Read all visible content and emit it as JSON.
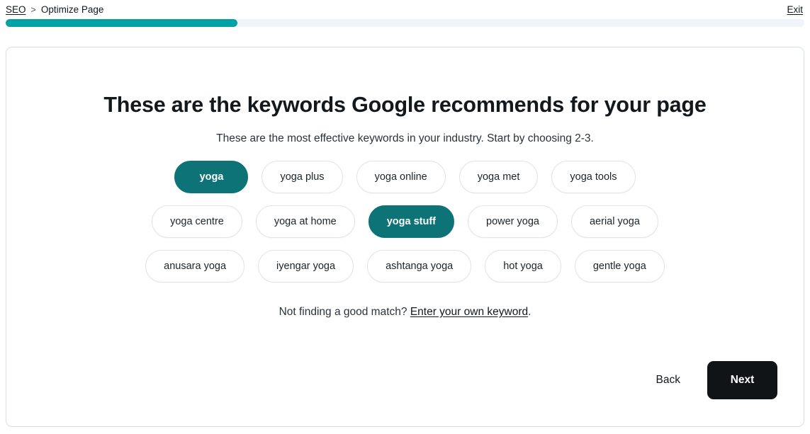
{
  "breadcrumb": {
    "root_label": "SEO",
    "separator": ">",
    "current_label": "Optimize Page"
  },
  "exit": {
    "label": "Exit"
  },
  "progress": {
    "percent": 29,
    "fill_color": "#00a2a6",
    "track_color": "#f1f4f9"
  },
  "main": {
    "headline": "These are the keywords Google recommends for your page",
    "subhead": "These are the most effective keywords in your industry. Start by choosing 2-3.",
    "selected_color": "#0d7377",
    "keyword_rows": [
      [
        {
          "label": "yoga",
          "selected": true
        },
        {
          "label": "yoga plus",
          "selected": false
        },
        {
          "label": "yoga online",
          "selected": false
        },
        {
          "label": "yoga met",
          "selected": false
        },
        {
          "label": "yoga tools",
          "selected": false
        }
      ],
      [
        {
          "label": "yoga centre",
          "selected": false
        },
        {
          "label": "yoga at home",
          "selected": false
        },
        {
          "label": "yoga stuff",
          "selected": true
        },
        {
          "label": "power yoga",
          "selected": false
        },
        {
          "label": "aerial yoga",
          "selected": false
        }
      ],
      [
        {
          "label": "anusara yoga",
          "selected": false
        },
        {
          "label": "iyengar yoga",
          "selected": false
        },
        {
          "label": "ashtanga yoga",
          "selected": false
        },
        {
          "label": "hot yoga",
          "selected": false
        },
        {
          "label": "gentle yoga",
          "selected": false
        }
      ]
    ],
    "own_keyword_prompt": "Not finding a good match?",
    "own_keyword_link": "Enter your own keyword",
    "own_keyword_suffix": "."
  },
  "footer": {
    "back_label": "Back",
    "next_label": "Next",
    "next_bg": "#111417"
  }
}
